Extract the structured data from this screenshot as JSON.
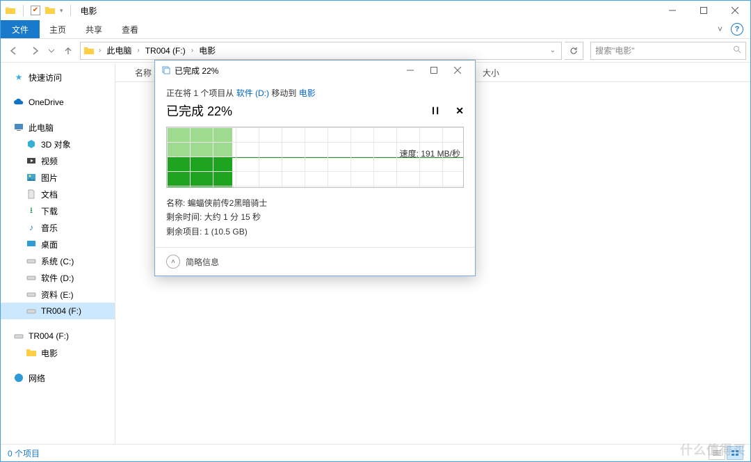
{
  "window": {
    "title": "电影",
    "ribbon": {
      "file": "文件",
      "home": "主页",
      "share": "共享",
      "view": "查看"
    }
  },
  "nav": {
    "breadcrumbs": [
      "此电脑",
      "TR004 (F:)",
      "电影"
    ],
    "search_placeholder": "搜索\"电影\""
  },
  "columns": {
    "name": "名称",
    "size": "大小"
  },
  "sidebar": {
    "quick_access": "快速访问",
    "onedrive": "OneDrive",
    "this_pc": "此电脑",
    "pc_children": {
      "objects3d": "3D 对象",
      "videos": "视频",
      "pictures": "图片",
      "documents": "文档",
      "downloads": "下载",
      "music": "音乐",
      "desktop": "桌面",
      "drive_c": "系统 (C:)",
      "drive_d": "软件 (D:)",
      "drive_e": "资料 (E:)",
      "drive_f": "TR004 (F:)"
    },
    "drive_f_root": "TR004 (F:)",
    "drive_f_child": "电影",
    "network": "网络"
  },
  "status": {
    "items": "0 个项目"
  },
  "dialog": {
    "title": "已完成 22%",
    "op_prefix": "正在将 1 个项目从 ",
    "op_src": "软件 (D:)",
    "op_mid": " 移动到 ",
    "op_dst": "电影",
    "percent_label": "已完成 22%",
    "speed_label": "速度: 191 MB/秒",
    "detail_name_label": "名称: ",
    "detail_name_value": "蝙蝠侠前传2黑暗骑士",
    "detail_time_label": "剩余时间: ",
    "detail_time_value": "大约 1 分 15 秒",
    "detail_items_label": "剩余项目: ",
    "detail_items_value": "1 (10.5 GB)",
    "more_details": "简略信息"
  },
  "watermark": "什么值得买"
}
